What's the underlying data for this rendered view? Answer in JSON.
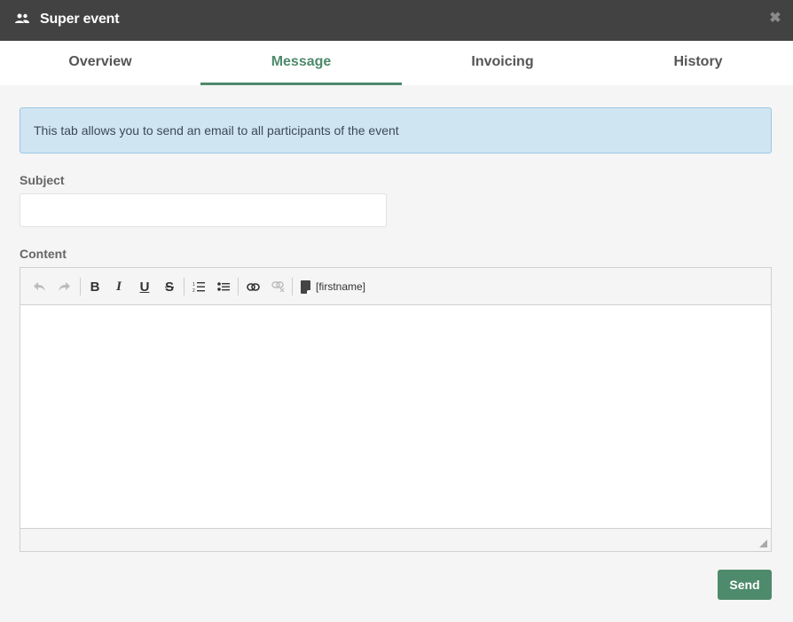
{
  "window": {
    "title": "Super event",
    "title_icon": "people-icon",
    "close_icon": "close-icon"
  },
  "tabs": [
    {
      "label": "Overview",
      "active": false
    },
    {
      "label": "Message",
      "active": true
    },
    {
      "label": "Invoicing",
      "active": false
    },
    {
      "label": "History",
      "active": false
    }
  ],
  "info_text": "This tab allows you to send an email to all participants of the event",
  "form": {
    "subject_label": "Subject",
    "subject_value": "",
    "content_label": "Content",
    "content_value": ""
  },
  "toolbar": {
    "buttons": [
      "undo-icon",
      "redo-icon",
      "bold-icon",
      "italic-icon",
      "underline-icon",
      "strikethrough-icon",
      "ordered-list-icon",
      "bullet-list-icon",
      "link-icon",
      "unlink-icon"
    ],
    "merge_field_label": "[firstname]"
  },
  "colors": {
    "accent": "#4e8a6c",
    "titlebar": "#424242",
    "info_bg": "#d0e5f2"
  },
  "actions": {
    "send_label": "Send"
  }
}
